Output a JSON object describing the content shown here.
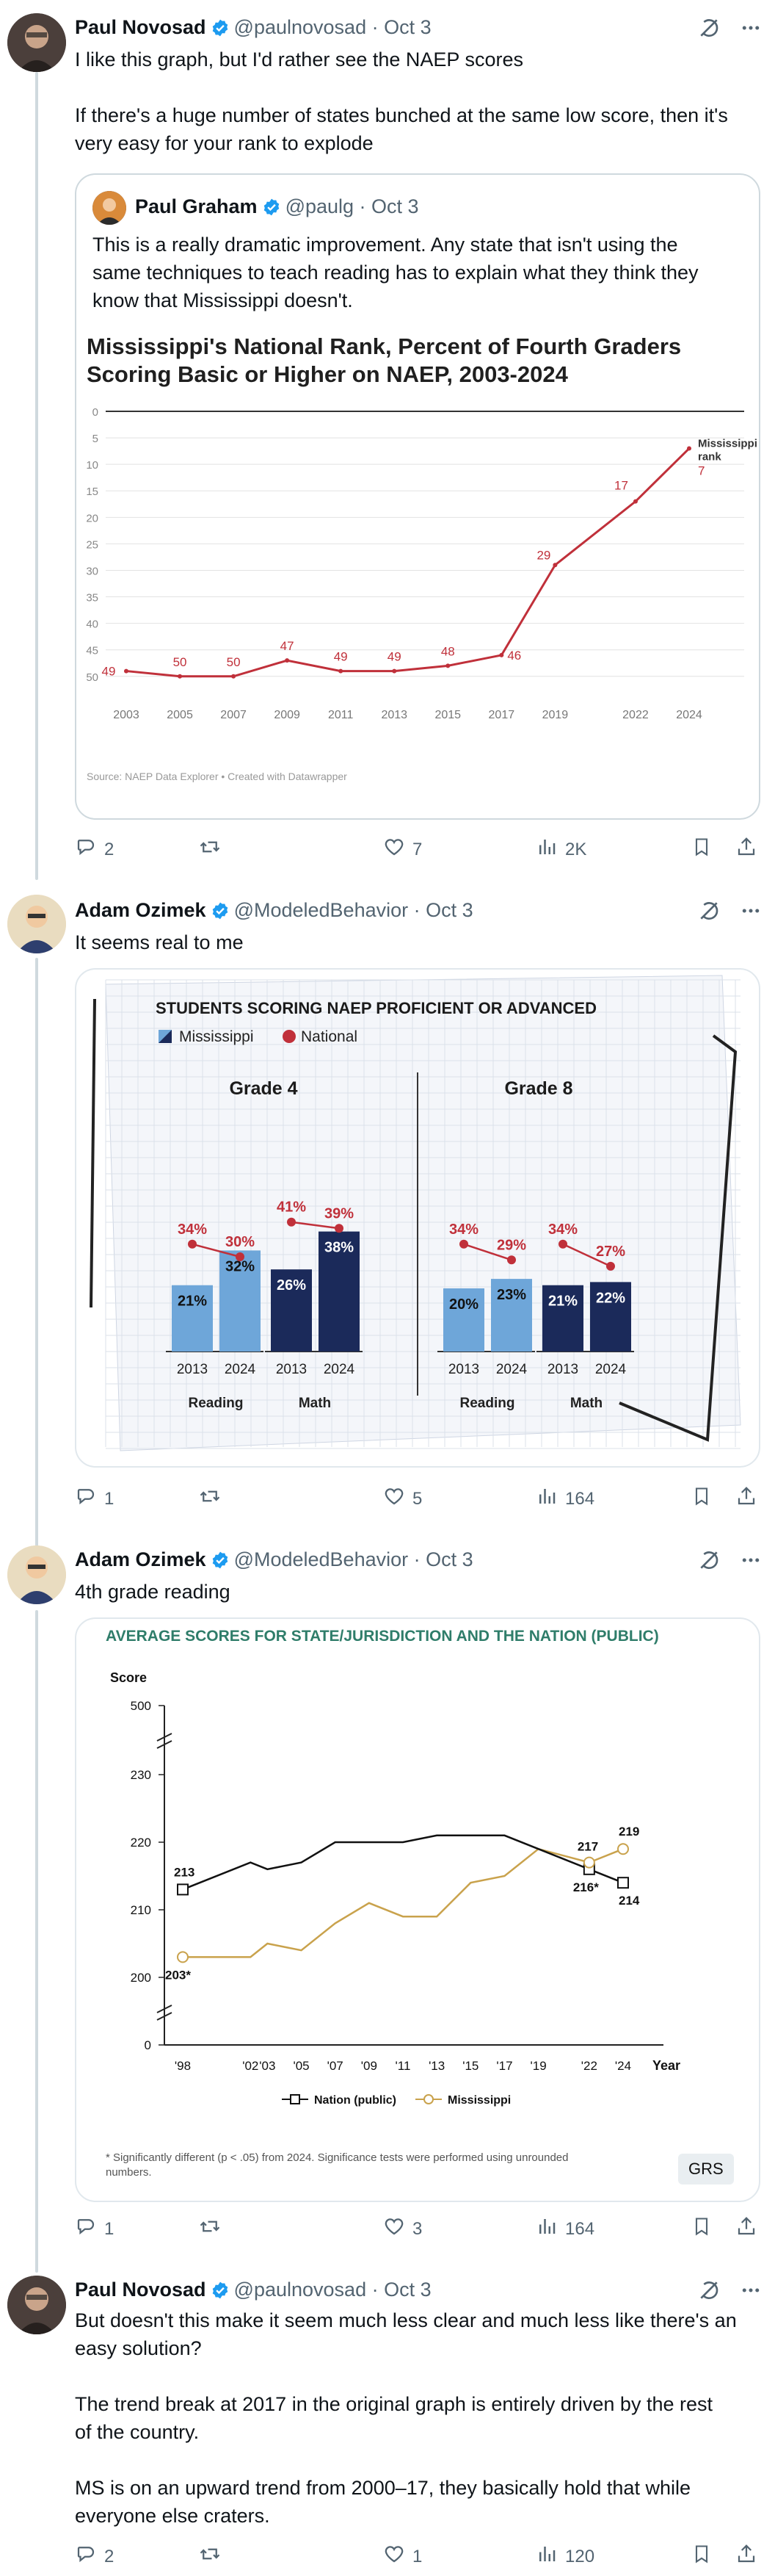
{
  "tweets": [
    {
      "name": "Paul Novosad",
      "handle": "@paulnovosad",
      "date": "Oct 3",
      "text_lines": [
        "I like this graph, but I'd rather see the NAEP scores"
      ],
      "text_lines2": [
        "If there's a huge number of states bunched at the same low score, then it's",
        "very easy for your rank to explode"
      ],
      "quote": {
        "name": "Paul Graham",
        "handle": "@paulg",
        "date": "Oct 3",
        "text_lines": [
          "This is a really dramatic improvement. Any state that isn't using the",
          "same techniques to teach reading has to explain what they think they",
          "know that Mississippi doesn't."
        ]
      },
      "stats": {
        "replies": "2",
        "retweets": "",
        "likes": "7",
        "views": "2K"
      }
    },
    {
      "name": "Adam Ozimek",
      "handle": "@ModeledBehavior",
      "date": "Oct 3",
      "text": "It seems real to me",
      "stats": {
        "replies": "1",
        "retweets": "",
        "likes": "5",
        "views": "164"
      }
    },
    {
      "name": "Adam Ozimek",
      "handle": "@ModeledBehavior",
      "date": "Oct 3",
      "text": "4th grade reading",
      "stats": {
        "replies": "1",
        "retweets": "",
        "likes": "3",
        "views": "164"
      },
      "badge": "GRS"
    },
    {
      "name": "Paul Novosad",
      "handle": "@paulnovosad",
      "date": "Oct 3",
      "paragraphs": [
        [
          "But doesn't this make it seem much less clear and much less like there's an",
          "easy solution?"
        ],
        [
          "The trend break at 2017 in the original graph is entirely driven by the rest",
          "of the country."
        ],
        [
          "MS is on an upward trend from 2000–17, they basically hold that while",
          "everyone else craters."
        ]
      ],
      "stats": {
        "replies": "2",
        "retweets": "",
        "likes": "1",
        "views": "120"
      }
    }
  ],
  "icons": {
    "reply": "reply-icon",
    "retweet": "retweet-icon",
    "like": "like-icon",
    "views": "views-icon",
    "bookmark": "bookmark-icon",
    "share": "share-icon",
    "grok": "grok-icon",
    "more": "more-icon"
  },
  "colors": {
    "accent": "#1d9bf0",
    "muted": "#536471",
    "chart_red": "#c0303a",
    "ms_light": "#6ea6d9",
    "ms_dark": "#1b2a5a",
    "gold": "#c9a24c"
  },
  "chart_data": [
    {
      "type": "line",
      "title": "Mississippi's National Rank, Percent of Fourth Graders",
      "title2": "Scoring Basic or Higher on NAEP, 2003-2024",
      "source": "Source: NAEP Data Explorer • Created with Datawrapper",
      "x": [
        2003,
        2005,
        2007,
        2009,
        2011,
        2013,
        2015,
        2017,
        2019,
        2022,
        2024
      ],
      "x_labels": [
        "2003",
        "2005",
        "2007",
        "2009",
        "2011",
        "2013",
        "2015",
        "2017",
        "2019",
        "2022",
        "2024"
      ],
      "series": [
        {
          "values": [
            49,
            50,
            50,
            47,
            49,
            49,
            48,
            46,
            29,
            17,
            7
          ]
        }
      ],
      "y_ticks": [
        "0",
        "5",
        "10",
        "15",
        "20",
        "25",
        "30",
        "35",
        "40",
        "45",
        "50"
      ],
      "ylim": [
        0,
        51
      ],
      "y_inverted": true,
      "end_label": [
        "Mississippi",
        "rank"
      ],
      "grid": true
    },
    {
      "type": "bar",
      "title": "STUDENTS SCORING NAEP PROFICIENT OR ADVANCED",
      "legend": [
        "Mississippi",
        "National"
      ],
      "panels": [
        {
          "title": "Grade 4",
          "groups": [
            {
              "name": "Reading",
              "years": [
                "2013",
                "2024"
              ],
              "ms": [
                21,
                32
              ],
              "nat": [
                34,
                30
              ],
              "ms_labels": [
                "21%",
                "32%"
              ],
              "nat_labels": [
                "34%",
                "30%"
              ]
            },
            {
              "name": "Math",
              "years": [
                "2013",
                "2024"
              ],
              "ms": [
                26,
                38
              ],
              "nat": [
                41,
                39
              ],
              "ms_labels": [
                "26%",
                "38%"
              ],
              "nat_labels": [
                "41%",
                "39%"
              ]
            }
          ]
        },
        {
          "title": "Grade 8",
          "groups": [
            {
              "name": "Reading",
              "years": [
                "2013",
                "2024"
              ],
              "ms": [
                20,
                23
              ],
              "nat": [
                34,
                29
              ],
              "ms_labels": [
                "20%",
                "23%"
              ],
              "nat_labels": [
                "34%",
                "29%"
              ]
            },
            {
              "name": "Math",
              "years": [
                "2013",
                "2024"
              ],
              "ms": [
                21,
                22
              ],
              "nat": [
                34,
                27
              ],
              "ms_labels": [
                "21%",
                "22%"
              ],
              "nat_labels": [
                "34%",
                "27%"
              ]
            }
          ]
        }
      ]
    },
    {
      "type": "line",
      "title": "AVERAGE SCORES FOR STATE/JURISDICTION AND THE NATION (PUBLIC)",
      "ylabel": "Score",
      "xlabel": "Year",
      "y_ticks": [
        "0",
        "200",
        "210",
        "220",
        "230",
        "500"
      ],
      "x": [
        1998,
        2002,
        2003,
        2005,
        2007,
        2009,
        2011,
        2013,
        2015,
        2017,
        2019,
        2022,
        2024
      ],
      "x_labels": [
        "'98",
        "'02",
        "'03",
        "'05",
        "'07",
        "'09",
        "'11",
        "'13",
        "'15",
        "'17",
        "'19",
        "'22",
        "'24"
      ],
      "series": [
        {
          "name": "Nation (public)",
          "values": [
            213,
            217,
            216,
            217,
            220,
            220,
            220,
            221,
            221,
            221,
            219,
            216,
            214
          ]
        },
        {
          "name": "Mississippi",
          "values": [
            203,
            203,
            205,
            204,
            208,
            211,
            209,
            209,
            214,
            215,
            219,
            217,
            219
          ]
        }
      ],
      "point_labels": {
        "nation_start": "213",
        "ms_start": "203*",
        "ms_2022": "217",
        "nation_2022": "216*",
        "ms_2024": "219",
        "nation_2024": "214"
      },
      "footnote": [
        "* Significantly different (p < .05) from 2024. Significance tests were performed using unrounded",
        "numbers."
      ]
    }
  ]
}
